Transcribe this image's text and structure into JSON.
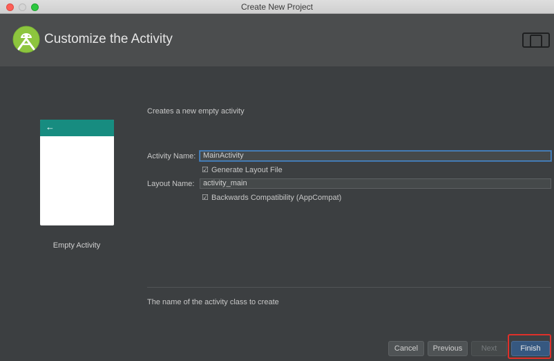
{
  "window": {
    "title": "Create New Project"
  },
  "header": {
    "title": "Customize the Activity"
  },
  "template": {
    "name": "Empty Activity",
    "back_glyph": "←"
  },
  "form": {
    "description": "Creates a new empty activity",
    "activity_name_label": "Activity Name:",
    "activity_name_value": "MainActivity",
    "generate_layout_label": "Generate Layout File",
    "generate_layout_checked": true,
    "layout_name_label": "Layout Name:",
    "layout_name_value": "activity_main",
    "backwards_compat_label": "Backwards Compatibility (AppCompat)",
    "backwards_compat_checked": true,
    "hint": "The name of the activity class to create"
  },
  "buttons": {
    "cancel": "Cancel",
    "previous": "Previous",
    "next": "Next",
    "finish": "Finish"
  },
  "colors": {
    "accent_teal": "#178c80",
    "focus_blue": "#4a88c7",
    "highlight_red": "#e0302a"
  }
}
